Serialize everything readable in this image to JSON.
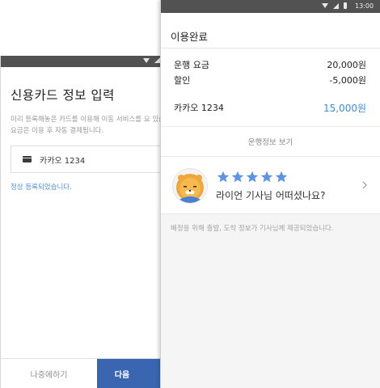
{
  "status_bar": {
    "time": "13:00"
  },
  "card_screen": {
    "title": "신용카드 정보 입력",
    "description": "미리 등록해놓은 카드를 이용해 이동 서비스를 요 있습니다. 요금은 이용 후 자동 결제됩니다.",
    "card_name": "카카오 1234",
    "registered_message": "정상 등록되었습니다.",
    "later_label": "나중에하기",
    "next_label": "다음"
  },
  "ride_screen": {
    "title": "이용완료",
    "fare_label": "운행 요금",
    "fare_value": "20,000원",
    "discount_label": "할인",
    "discount_value": "-5,000원",
    "card_label": "카카오 1234",
    "total_value": "15,000원",
    "detail_link": "운행정보 보기",
    "rating_stars": 5,
    "rating_prompt": "라이언 기사님 어떠셨나요?",
    "footer_note": "배정을 위해 출발, 도착 정보가 기사님께 제공되었습니다."
  },
  "colors": {
    "accent_blue": "#3d8be0",
    "button_blue": "#3a66b1",
    "star_blue": "#5d94e8"
  },
  "icons": [
    "wifi-icon",
    "signal-icon",
    "battery-icon",
    "credit-card-icon",
    "star-icon",
    "chevron-right-icon",
    "lion-avatar"
  ]
}
